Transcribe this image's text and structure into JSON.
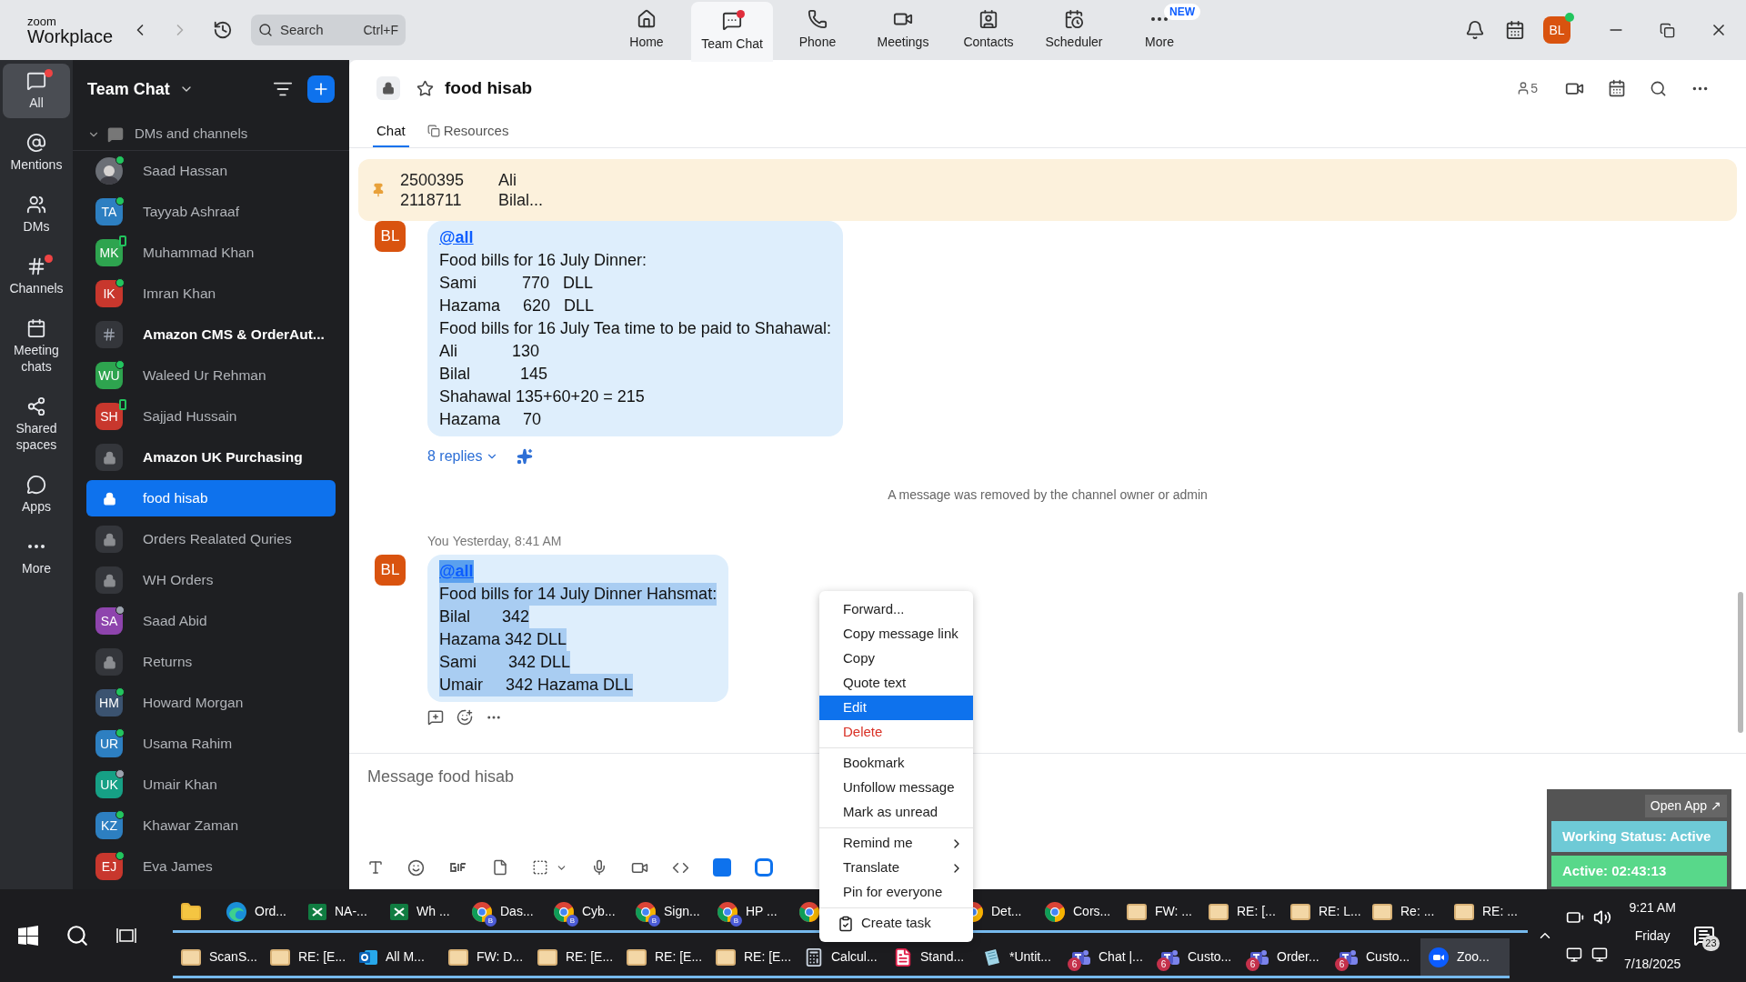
{
  "app": {
    "logo_top": "zoom",
    "logo_bottom": "Workplace",
    "search": {
      "placeholder": "Search",
      "shortcut": "Ctrl+F"
    },
    "nav": [
      {
        "kind": "home",
        "label": "Home",
        "selected": false,
        "dot": false
      },
      {
        "kind": "chat",
        "label": "Team Chat",
        "selected": true,
        "dot": true
      },
      {
        "kind": "phone",
        "label": "Phone",
        "selected": false,
        "dot": false
      },
      {
        "kind": "meetings",
        "label": "Meetings",
        "selected": false,
        "dot": false
      },
      {
        "kind": "contacts",
        "label": "Contacts",
        "selected": false,
        "dot": false
      },
      {
        "kind": "scheduler",
        "label": "Scheduler",
        "selected": false,
        "dot": false
      },
      {
        "kind": "more",
        "label": "More",
        "selected": false,
        "dot": false,
        "badge": "NEW"
      }
    ],
    "user_initials": "BL"
  },
  "rail": [
    {
      "kind": "all",
      "label": "All",
      "selected": true,
      "dot": true
    },
    {
      "kind": "mentions",
      "label": "Mentions",
      "selected": false,
      "dot": false
    },
    {
      "kind": "dms",
      "label": "DMs",
      "selected": false,
      "dot": false
    },
    {
      "kind": "channels",
      "label": "Channels",
      "selected": false,
      "dot": true
    },
    {
      "kind": "meeting",
      "label": "Meeting chats",
      "selected": false,
      "dot": false
    },
    {
      "kind": "shared",
      "label": "Shared spaces",
      "selected": false,
      "dot": false
    },
    {
      "kind": "apps",
      "label": "Apps",
      "selected": false,
      "dot": false
    },
    {
      "kind": "more",
      "label": "More",
      "selected": false,
      "dot": false
    }
  ],
  "sidebar": {
    "title": "Team Chat",
    "section": "DMs and channels",
    "expanded": true,
    "items": [
      {
        "kind": "photo",
        "name": "Saad Hassan",
        "status": {
          "kind": "online"
        },
        "bold": false,
        "selected": false
      },
      {
        "kind": "person",
        "initials": "TA",
        "color": "#2d7fc1",
        "name": "Tayyab Ashraaf",
        "status": {
          "kind": "online"
        },
        "bold": false,
        "selected": false
      },
      {
        "kind": "person",
        "initials": "MK",
        "color": "#2ea44f",
        "name": "Muhammad Khan",
        "status": {
          "kind": "mobile"
        },
        "bold": false,
        "selected": false
      },
      {
        "kind": "person",
        "initials": "IK",
        "color": "#c8372d",
        "name": "Imran Khan",
        "status": {
          "kind": "online"
        },
        "bold": false,
        "selected": false
      },
      {
        "kind": "channel",
        "name": "Amazon CMS & OrderAut...",
        "bold": true,
        "selected": false
      },
      {
        "kind": "person",
        "initials": "WU",
        "color": "#2ea44f",
        "name": "Waleed Ur Rehman",
        "status": {
          "kind": "online"
        },
        "bold": false,
        "selected": false
      },
      {
        "kind": "person",
        "initials": "SH",
        "color": "#c8372d",
        "name": "Sajjad Hussain",
        "status": {
          "kind": "mobile"
        },
        "bold": false,
        "selected": false
      },
      {
        "kind": "private",
        "name": "Amazon UK Purchasing",
        "bold": true,
        "selected": false
      },
      {
        "kind": "private",
        "name": "food hisab",
        "bold": false,
        "selected": true
      },
      {
        "kind": "private",
        "name": "Orders Realated Quries",
        "bold": false,
        "selected": false
      },
      {
        "kind": "private",
        "name": "WH Orders",
        "bold": false,
        "selected": false
      },
      {
        "kind": "person",
        "initials": "SA",
        "color": "#8e44ad",
        "name": "Saad Abid",
        "status": {
          "kind": "away"
        },
        "bold": false,
        "selected": false
      },
      {
        "kind": "private",
        "name": "Returns",
        "bold": false,
        "selected": false
      },
      {
        "kind": "person",
        "initials": "HM",
        "color": "#3b5370",
        "name": "Howard Morgan",
        "status": {
          "kind": "online"
        },
        "bold": false,
        "selected": false
      },
      {
        "kind": "person",
        "initials": "UR",
        "color": "#2d7fc1",
        "name": "Usama Rahim",
        "status": {
          "kind": "online"
        },
        "bold": false,
        "selected": false
      },
      {
        "kind": "person",
        "initials": "UK",
        "color": "#16a085",
        "name": "Umair Khan",
        "status": {
          "kind": "away"
        },
        "bold": false,
        "selected": false
      },
      {
        "kind": "person",
        "initials": "KZ",
        "color": "#2d7fc1",
        "name": "Khawar Zaman",
        "status": {
          "kind": "online"
        },
        "bold": false,
        "selected": false
      },
      {
        "kind": "person",
        "initials": "EJ",
        "color": "#c8372d",
        "name": "Eva James",
        "status": {
          "kind": "online"
        },
        "bold": false,
        "selected": false
      }
    ]
  },
  "chat": {
    "title": "food hisab",
    "members": "5",
    "tabs": [
      {
        "label": "Chat",
        "selected": true
      },
      {
        "label": "Resources",
        "selected": false
      }
    ],
    "pinned": [
      [
        "2500395",
        "Ali"
      ],
      [
        "2118711",
        "Bilal..."
      ]
    ],
    "messages": [
      {
        "avatar": "BL",
        "lines": [
          {
            "kind": "mention",
            "text": "@all",
            "selected": false
          },
          {
            "kind": "text",
            "text": "Food bills for 16 July Dinner:",
            "selected": false
          },
          {
            "kind": "text",
            "text": "Sami          770   DLL",
            "selected": false
          },
          {
            "kind": "text",
            "text": "Hazama     620   DLL",
            "selected": false
          },
          {
            "kind": "text",
            "text": "Food bills for 16 July Tea time to be paid to Shahawal:",
            "selected": false
          },
          {
            "kind": "text",
            "text": "Ali            130",
            "selected": false
          },
          {
            "kind": "text",
            "text": "Bilal           145",
            "selected": false
          },
          {
            "kind": "text",
            "text": "Shahawal 135+60+20 = 215",
            "selected": false
          },
          {
            "kind": "text",
            "text": "Hazama     70",
            "selected": false
          }
        ],
        "replies": "8 replies"
      },
      {
        "notice": "A message was removed by the channel owner or admin"
      },
      {
        "avatar": "BL",
        "sender": "You",
        "time": "Yesterday, 8:41 AM",
        "lines": [
          {
            "kind": "mention",
            "text": "@all",
            "selected": true
          },
          {
            "kind": "text",
            "text": "Food bills for 14 July Dinner Hahsmat:",
            "selected": true
          },
          {
            "kind": "text",
            "text": "Bilal       342",
            "selected": true
          },
          {
            "kind": "text",
            "text": "Hazama 342 DLL",
            "selected": true
          },
          {
            "kind": "text",
            "text": "Sami       342 DLL",
            "selected": true
          },
          {
            "kind": "text",
            "text": "Umair     342 Hazama DLL",
            "selected": true
          }
        ],
        "actions": true
      }
    ],
    "composer_placeholder": "Message food hisab"
  },
  "context_menu": [
    [
      {
        "kind": "item",
        "label": "Forward...",
        "selected": false
      },
      {
        "kind": "item",
        "label": "Copy message link",
        "selected": false
      },
      {
        "kind": "item",
        "label": "Copy",
        "selected": false
      },
      {
        "kind": "item",
        "label": "Quote text",
        "selected": false
      },
      {
        "kind": "item",
        "label": "Edit",
        "selected": true
      },
      {
        "kind": "danger",
        "label": "Delete",
        "selected": false
      }
    ],
    [
      {
        "kind": "item",
        "label": "Bookmark",
        "selected": false
      },
      {
        "kind": "item",
        "label": "Unfollow message",
        "selected": false
      },
      {
        "kind": "item",
        "label": "Mark as unread",
        "selected": false
      }
    ],
    [
      {
        "kind": "submenu",
        "label": "Remind me",
        "selected": false
      },
      {
        "kind": "submenu",
        "label": "Translate",
        "selected": false
      },
      {
        "kind": "item",
        "label": "Pin for everyone",
        "selected": false
      }
    ],
    [
      {
        "kind": "task",
        "label": "Create task",
        "selected": false
      }
    ]
  ],
  "widget": {
    "open_app": "Open App ↗",
    "status": "Working Status: Active",
    "timer": "Active: 02:43:13"
  },
  "taskbar": {
    "row_1_left": [
      {
        "kind": "folder"
      },
      {
        "kind": "edge",
        "label": "Ord..."
      },
      {
        "kind": "excel",
        "label": "NA-..."
      },
      {
        "kind": "excel",
        "label": "Wh ..."
      },
      {
        "kind": "chrome",
        "label": "Das...",
        "profile": "B"
      },
      {
        "kind": "chrome",
        "label": "Cyb...",
        "profile": "B"
      },
      {
        "kind": "chrome",
        "label": "Sign...",
        "profile": "B"
      },
      {
        "kind": "chrome",
        "label": "HP ...",
        "profile": "B"
      },
      {
        "kind": "chrome"
      }
    ],
    "row_1_right": [
      {
        "kind": "chrome",
        "label": "Det..."
      },
      {
        "kind": "chrome",
        "label": "Cors..."
      },
      {
        "kind": "mail",
        "label": "FW: ..."
      },
      {
        "kind": "mail",
        "label": "RE: [..."
      },
      {
        "kind": "mail",
        "label": "RE: L..."
      },
      {
        "kind": "mail",
        "label": "Re: ..."
      },
      {
        "kind": "mail",
        "label": "RE: ..."
      }
    ],
    "row_2": [
      {
        "kind": "mail",
        "label": "ScanS..."
      },
      {
        "kind": "mail",
        "label": "RE: [E..."
      },
      {
        "kind": "outlook",
        "label": "All M..."
      },
      {
        "kind": "mail",
        "label": "FW: D..."
      },
      {
        "kind": "mail",
        "label": "RE: [E..."
      },
      {
        "kind": "mail",
        "label": "RE: [E..."
      },
      {
        "kind": "mail",
        "label": "RE: [E..."
      },
      {
        "kind": "calc",
        "label": "Calcul..."
      },
      {
        "kind": "pdf",
        "label": "Stand..."
      },
      {
        "kind": "notepad",
        "label": "*Untit..."
      },
      {
        "kind": "teams",
        "label": "Chat |...",
        "badge": "6"
      },
      {
        "kind": "teams",
        "label": "Custo...",
        "badge": "6"
      },
      {
        "kind": "teams",
        "label": "Order...",
        "badge": "6"
      },
      {
        "kind": "teams",
        "label": "Custo...",
        "badge": "6"
      },
      {
        "kind": "zoom",
        "label": "Zoo...",
        "selected": true
      }
    ],
    "time": "9:21 AM",
    "day": "Friday",
    "date": "7/18/2025",
    "notifications": "23"
  }
}
